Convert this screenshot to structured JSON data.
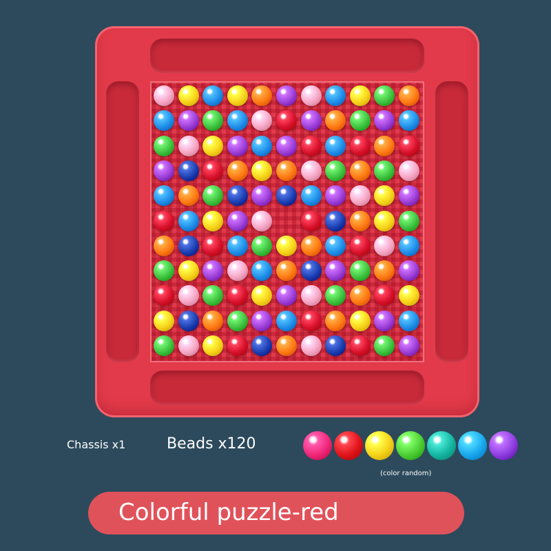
{
  "board": {
    "bead_colors": {
      "pink": "#f6a6c3",
      "yellow": "#f8d31a",
      "blue": "#1f8ee8",
      "red": "#d8112c",
      "orange": "#ff7a12",
      "purple": "#9c3fd6",
      "green": "#3fc23f",
      "navy": "#1b3fb0"
    },
    "rows": [
      [
        "pink",
        "yellow",
        "blue",
        "yellow",
        "orange",
        "purple",
        "pink",
        "blue",
        "yellow",
        "green",
        "orange"
      ],
      [
        "blue",
        "purple",
        "green",
        "blue",
        "pink",
        "red",
        "purple",
        "orange",
        "green",
        "purple",
        "blue"
      ],
      [
        "green",
        "pink",
        "yellow",
        "purple",
        "blue",
        "purple",
        "red",
        "blue",
        "red",
        "orange",
        "red"
      ],
      [
        "purple",
        "navy",
        "red",
        "orange",
        "yellow",
        "orange",
        "pink",
        "green",
        "orange",
        "green",
        "pink"
      ],
      [
        "blue",
        "orange",
        "green",
        "navy",
        "purple",
        "navy",
        "blue",
        "purple",
        "pink",
        "yellow",
        "purple"
      ],
      [
        "red",
        "blue",
        "yellow",
        "purple",
        "pink",
        "",
        "red",
        "navy",
        "orange",
        "yellow",
        "green"
      ],
      [
        "orange",
        "navy",
        "red",
        "blue",
        "green",
        "yellow",
        "orange",
        "blue",
        "red",
        "pink",
        "blue"
      ],
      [
        "green",
        "yellow",
        "purple",
        "pink",
        "blue",
        "orange",
        "navy",
        "purple",
        "green",
        "orange",
        "purple"
      ],
      [
        "red",
        "pink",
        "green",
        "red",
        "yellow",
        "purple",
        "pink",
        "green",
        "orange",
        "red",
        "yellow"
      ],
      [
        "yellow",
        "navy",
        "orange",
        "green",
        "purple",
        "blue",
        "red",
        "orange",
        "yellow",
        "purple",
        "blue"
      ],
      [
        "green",
        "pink",
        "yellow",
        "red",
        "navy",
        "orange",
        "pink",
        "navy",
        "red",
        "green",
        "purple"
      ]
    ]
  },
  "legend": {
    "chassis_label": "Chassis x1",
    "beads_label": "Beads x120",
    "sample_colors": [
      "#f0287a",
      "#e0141c",
      "#f6d21a",
      "#4fcf35",
      "#16b7a2",
      "#1aa8ef",
      "#8f3fe0"
    ],
    "color_note": "(color random)"
  },
  "product": {
    "title": "Colorful puzzle-red"
  }
}
